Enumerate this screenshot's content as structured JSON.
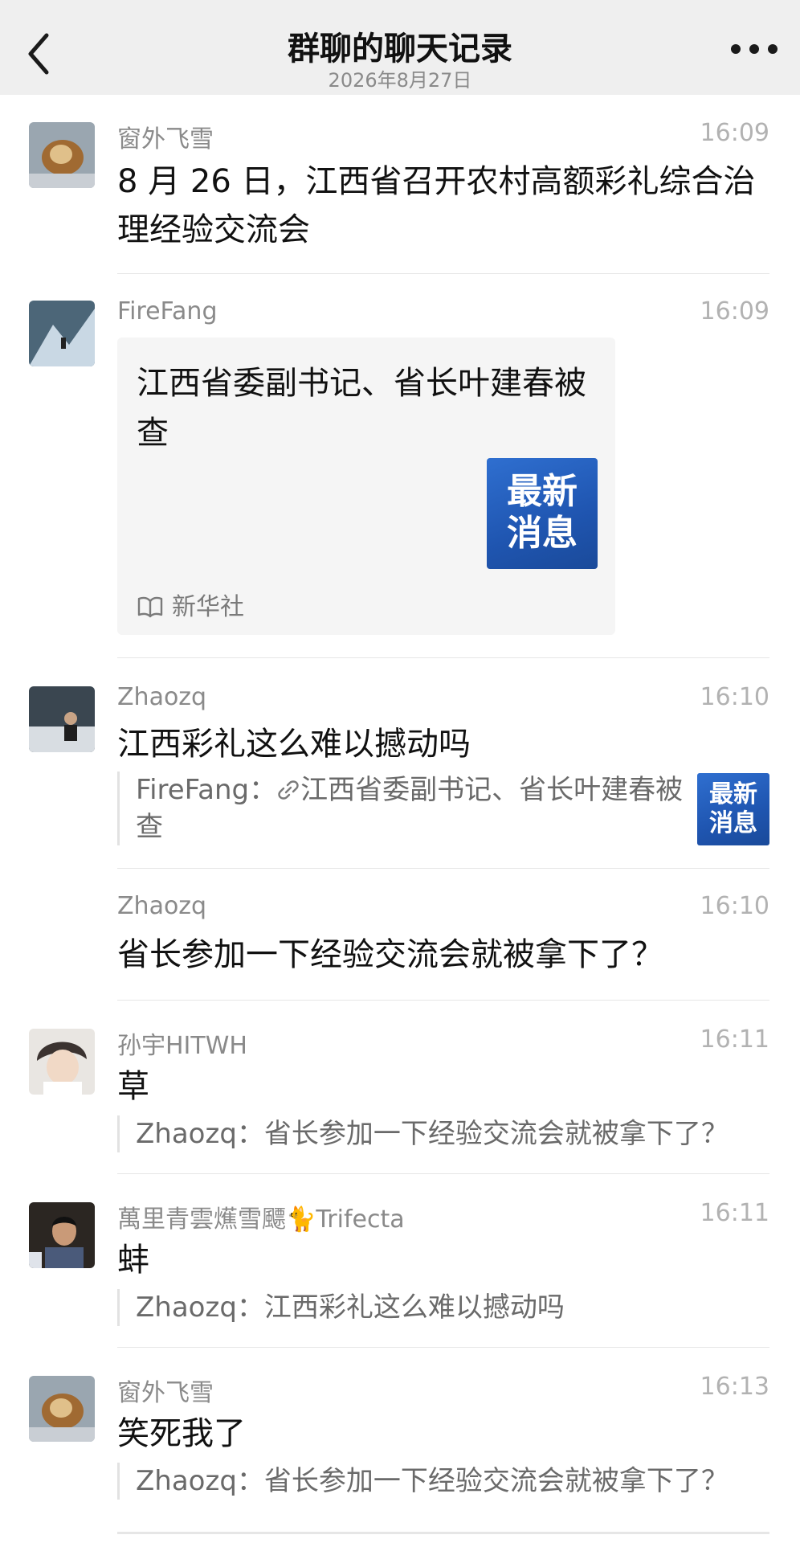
{
  "header": {
    "title": "群聊的聊天记录",
    "date": "2026年8月27日"
  },
  "messages": [
    {
      "sender": "窗外飞雪",
      "time": "16:09",
      "text": "8 月 26 日，江西省召开农村高额彩礼综合治理经验交流会"
    },
    {
      "sender": "FireFang",
      "time": "16:09",
      "card": {
        "title": "江西省委副书记、省长叶建春被查",
        "thumb_line1": "最新",
        "thumb_line2": "消息",
        "source": "新华社"
      }
    },
    {
      "sender": "Zhaozq",
      "time": "16:10",
      "text": "江西彩礼这么难以撼动吗",
      "quote_sender": "FireFang：",
      "quote_text": "江西省委副书记、省长叶建春被查",
      "quote_thumb_line1": "最新",
      "quote_thumb_line2": "消息"
    },
    {
      "sender": "Zhaozq",
      "time": "16:10",
      "text": "省长参加一下经验交流会就被拿下了？"
    },
    {
      "sender": "孙宇HITWH",
      "time": "16:11",
      "text": "草",
      "quote": "Zhaozq：省长参加一下经验交流会就被拿下了？"
    },
    {
      "sender": "萬里青雲爑雪飃🐈Trifecta",
      "time": "16:11",
      "text": "蚌",
      "quote": "Zhaozq：江西彩礼这么难以撼动吗"
    },
    {
      "sender": "窗外飞雪",
      "time": "16:13",
      "text": "笑死我了",
      "quote": "Zhaozq：省长参加一下经验交流会就被拿下了？"
    }
  ],
  "icons": {
    "back": "chevron-left-icon",
    "more": "more-dots-icon",
    "source": "book-icon",
    "link": "link-icon"
  }
}
